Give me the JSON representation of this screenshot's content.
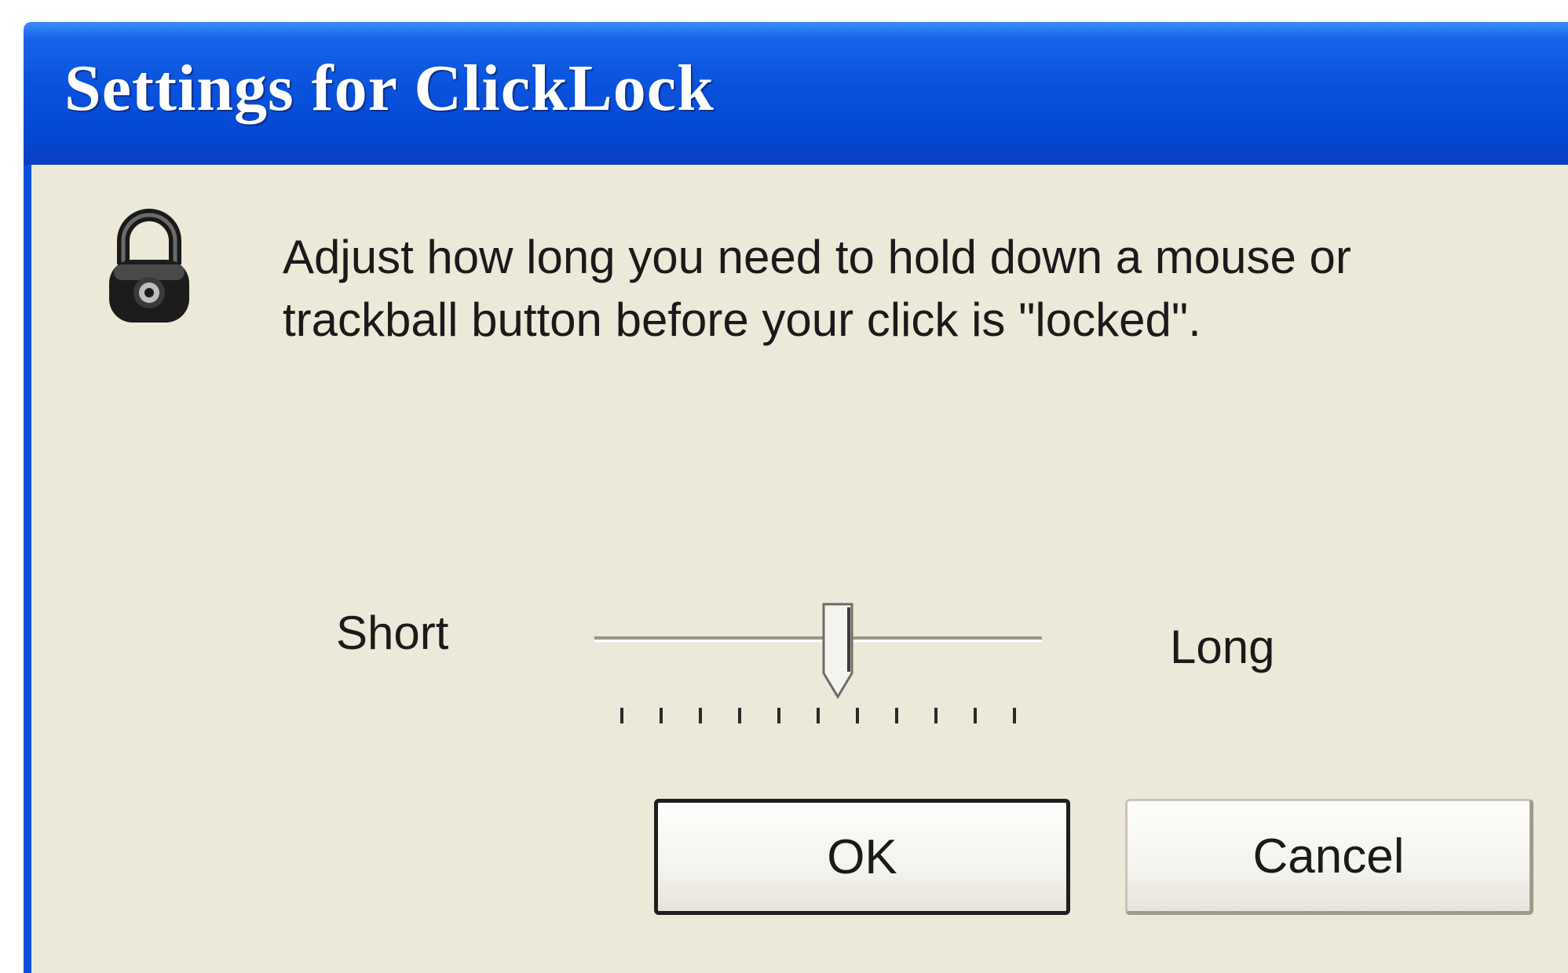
{
  "window": {
    "title": "Settings for ClickLock"
  },
  "content": {
    "icon": "padlock-icon",
    "message": "Adjust how long you need to hold down a mouse or trackball button before your click is \"locked\"."
  },
  "slider": {
    "min_label": "Short",
    "max_label": "Long",
    "tick_count": 11,
    "value_fraction": 0.55
  },
  "buttons": {
    "ok_label": "OK",
    "cancel_label": "Cancel"
  },
  "colors": {
    "titlebar": "#0a52dc",
    "dialog_face": "#ece9d8"
  }
}
